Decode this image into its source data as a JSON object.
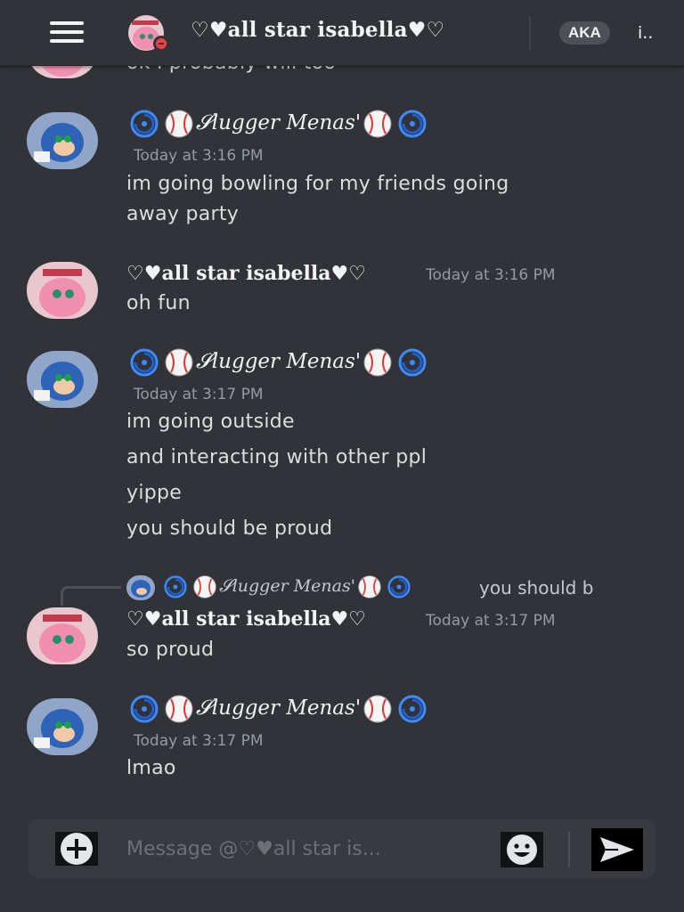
{
  "header": {
    "title": "♡♥all star isabella♥♡",
    "aka_badge": "AKA",
    "aka_name": "i.."
  },
  "users": {
    "isabella": "♡♥all star isabella♥♡",
    "menas": "𝓢lugger Menas'"
  },
  "partial_top_message": "ok i probably will too",
  "messages": [
    {
      "author": "menas",
      "timestamp": "Today at 3:16 PM",
      "lines": [
        "im going bowling for my friends going",
        "away party"
      ]
    },
    {
      "author": "isabella",
      "timestamp": "Today at 3:16 PM",
      "lines": [
        "oh fun"
      ]
    },
    {
      "author": "menas",
      "timestamp": "Today at 3:17 PM",
      "lines": [
        "im going outside",
        "and interacting with other ppl",
        "yippe",
        "you should be proud"
      ]
    },
    {
      "author": "isabella",
      "timestamp": "Today at 3:17 PM",
      "reply": {
        "author": "menas",
        "preview": "you should b"
      },
      "lines": [
        "so proud"
      ]
    },
    {
      "author": "menas",
      "timestamp": "Today at 3:17 PM",
      "lines": [
        "lmao"
      ]
    }
  ],
  "composer": {
    "placeholder": "Message @♡♥all star is..."
  },
  "icons": {
    "menu": "hamburger-icon",
    "add": "plus-circle-icon",
    "emoji": "smiley-icon",
    "send": "send-arrow-icon",
    "status": "do-not-disturb-icon"
  },
  "colors": {
    "background": "#313338",
    "composer": "#383a40",
    "text": "#dbdee1",
    "muted": "#949ba4",
    "dnd": "#f23f43"
  }
}
